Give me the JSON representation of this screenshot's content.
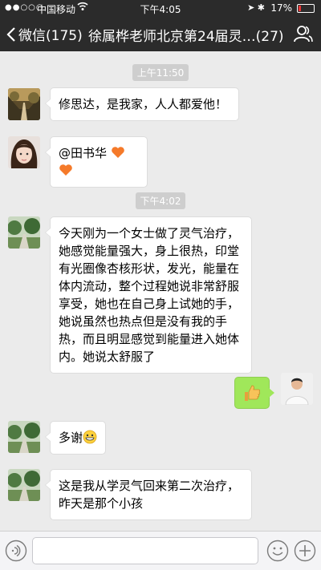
{
  "status_bar": {
    "signal": "●●○○○",
    "carrier": "中国移动",
    "time": "下午4:05",
    "battery": "17%",
    "battery_level": 0.17
  },
  "nav": {
    "back_label": "微信(175)",
    "title": "徐属桦老师北京第24届灵…(27)"
  },
  "messages": [
    {
      "type": "time",
      "text": "上午11:50"
    },
    {
      "type": "left",
      "avatar": "forest-path-avatar",
      "text": "修思达，是我家，人人都爱他！"
    },
    {
      "type": "left",
      "avatar": "woman-avatar",
      "text": "@田书华",
      "emoji": [
        "heart-icon",
        "heart-icon"
      ]
    },
    {
      "type": "time",
      "text": "下午4:02"
    },
    {
      "type": "left",
      "avatar": "garden-avatar",
      "text": "今天刚为一个女士做了灵气治疗，她感觉能量强大，身上很热，印堂有光圈像杏核形状，发光，能量在体内流动，整个过程她说非常舒服享受，她也在自己身上试她的手，她说虽然也热点但是没有我的手热，而且明显感觉到能量进入她体内。她说太舒服了"
    },
    {
      "type": "right",
      "avatar": "man-avatar",
      "emoji": [
        "thumbs-up-icon"
      ]
    },
    {
      "type": "left",
      "avatar": "garden-avatar",
      "text": "多谢",
      "emoji": [
        "grin-icon"
      ]
    },
    {
      "type": "left",
      "avatar": "garden-avatar",
      "text": "这是我从学灵气回来第二次治疗，昨天是那个小孩"
    }
  ]
}
